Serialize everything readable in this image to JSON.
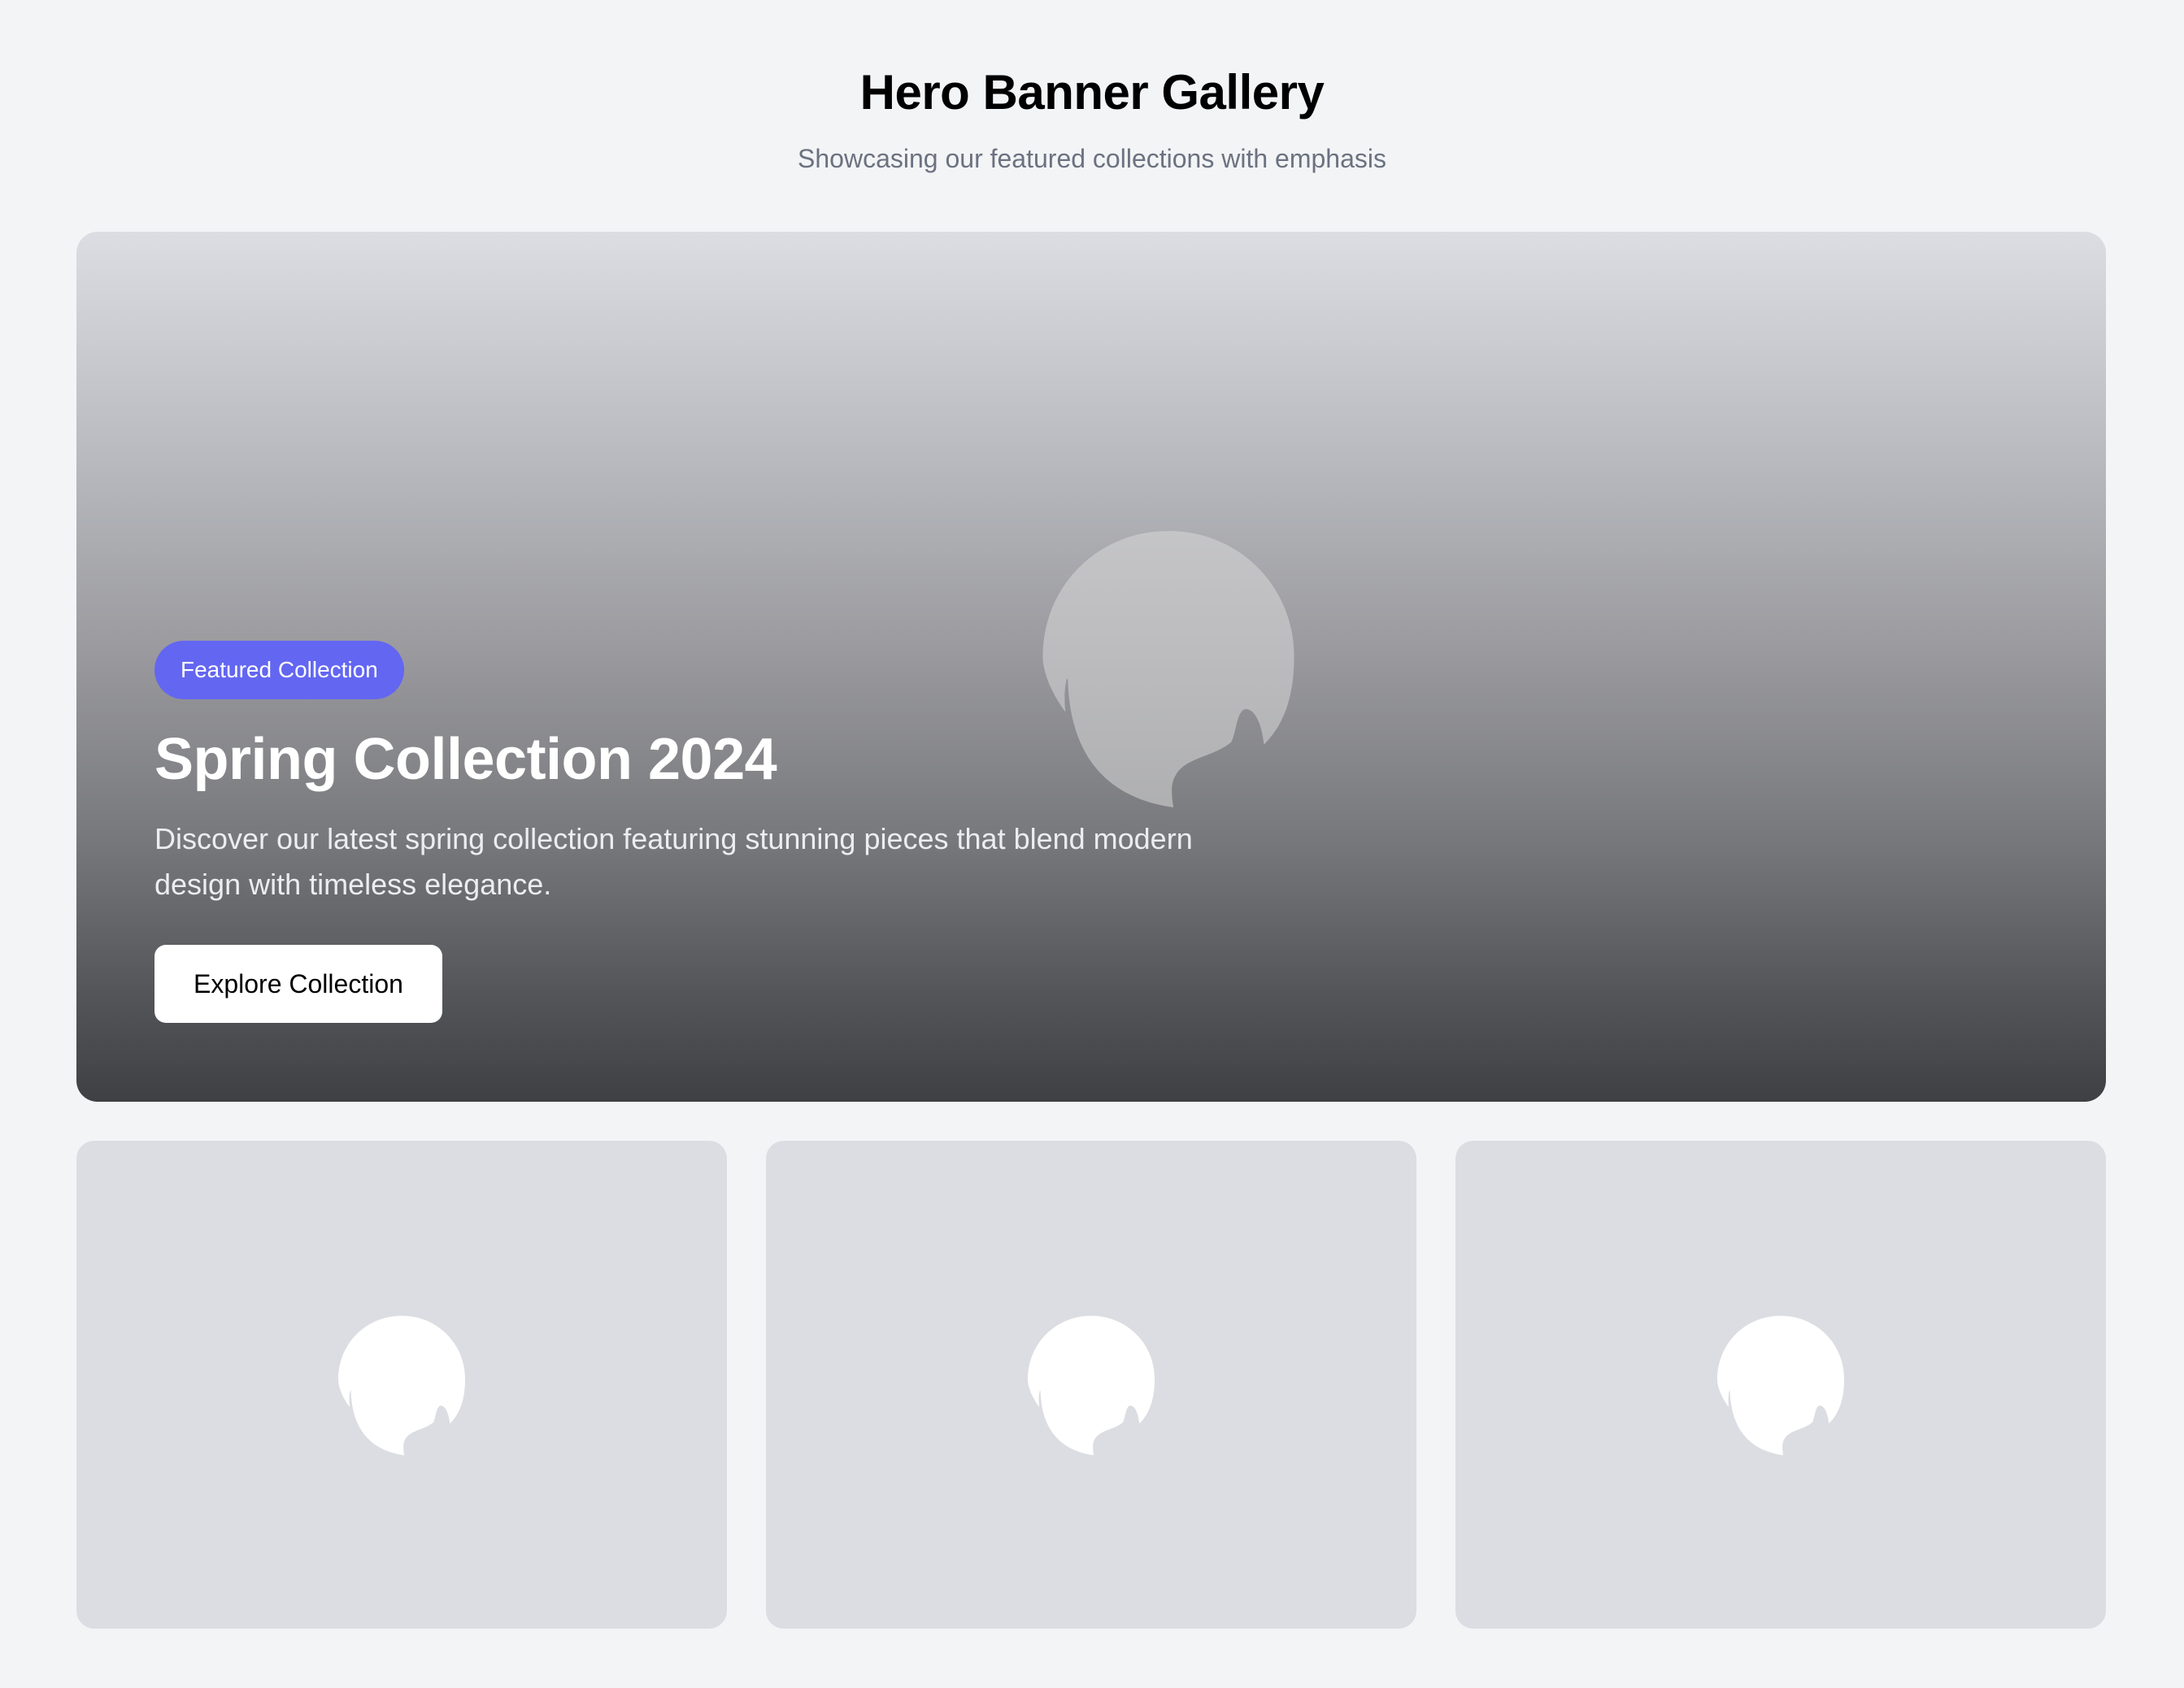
{
  "header": {
    "title": "Hero Banner Gallery",
    "subtitle": "Showcasing our featured collections with emphasis"
  },
  "hero": {
    "badge": "Featured Collection",
    "title": "Spring Collection 2024",
    "description": "Discover our latest spring collection featuring stunning pieces that blend modern design with timeless elegance.",
    "button_label": "Explore Collection",
    "image_icon": "image-placeholder-icon"
  },
  "thumbnails": [
    {
      "icon": "image-placeholder-icon"
    },
    {
      "icon": "image-placeholder-icon"
    },
    {
      "icon": "image-placeholder-icon"
    }
  ],
  "colors": {
    "page_background": "#f3f4f6",
    "badge": "#6366f1",
    "subtitle": "#6b7280",
    "thumbnail_background": "#dcdde2",
    "button_background": "#ffffff"
  }
}
